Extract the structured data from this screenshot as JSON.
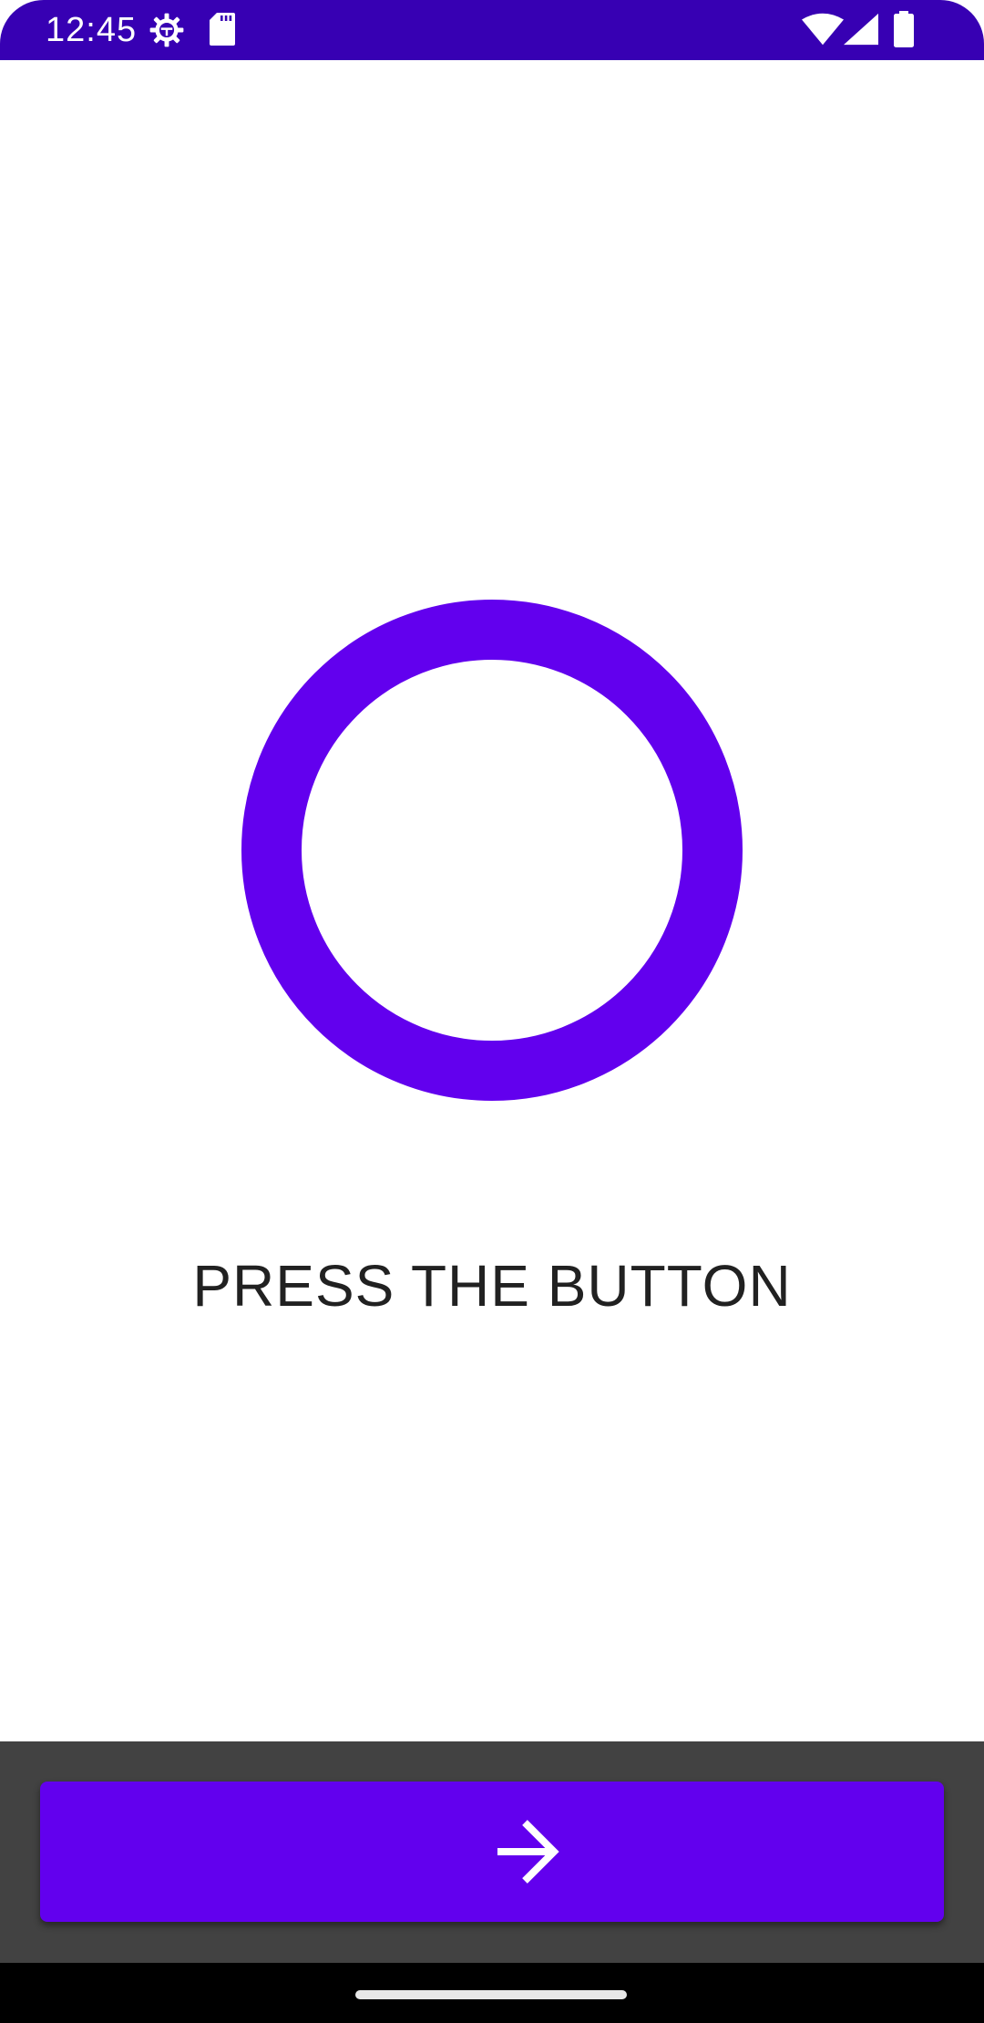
{
  "status_bar": {
    "time": "12:45",
    "icons": [
      "gear-icon",
      "sd-card-icon",
      "wifi-icon",
      "cell-signal-icon",
      "battery-icon"
    ],
    "background": "#3700b3"
  },
  "main": {
    "indicator": "ring-indicator",
    "prompt": "PRESS THE BUTTON",
    "accent": "#6200ee"
  },
  "bottom_panel": {
    "background": "#424242",
    "button_icon": "arrow-right-icon",
    "button_color": "#6200ee"
  },
  "nav_bar": {
    "background": "#000000",
    "handle": "home-handle"
  }
}
